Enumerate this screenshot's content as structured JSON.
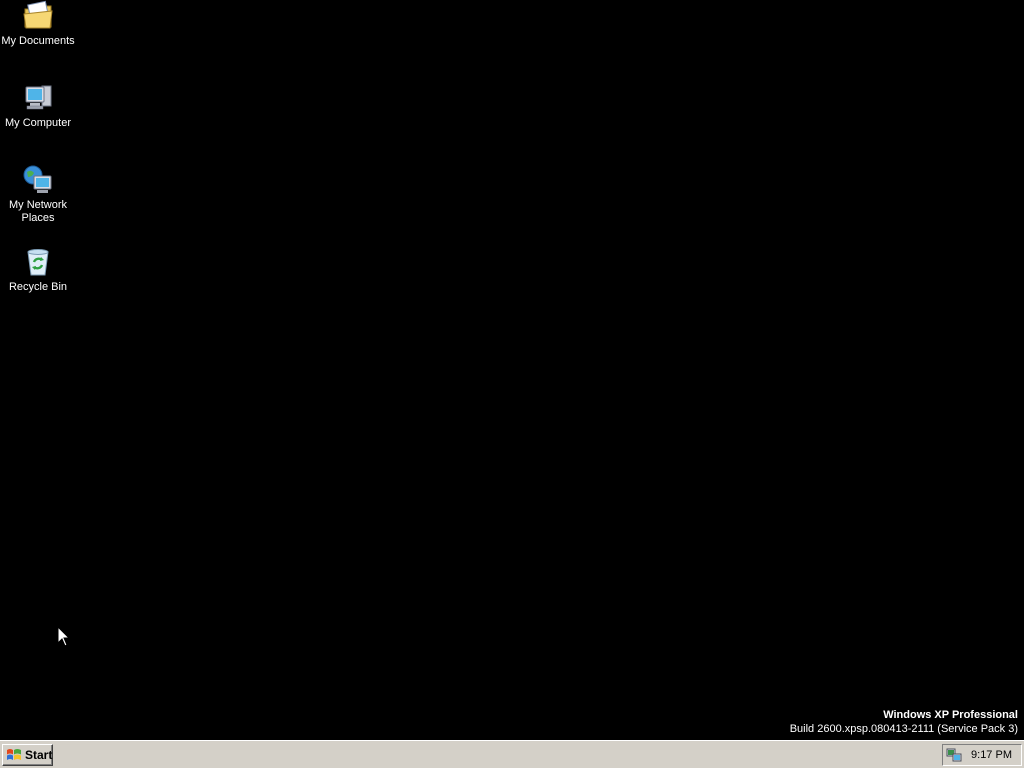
{
  "desktop": {
    "background_color": "#000000",
    "icons": [
      {
        "label": "My Documents",
        "icon": "my-documents-icon"
      },
      {
        "label": "My Computer",
        "icon": "my-computer-icon"
      },
      {
        "label": "My Network Places",
        "icon": "my-network-places-icon"
      },
      {
        "label": "Recycle Bin",
        "icon": "recycle-bin-icon"
      }
    ],
    "watermark": {
      "title": "Windows XP Professional",
      "build": "Build 2600.xpsp.080413-2111 (Service Pack 3)"
    }
  },
  "taskbar": {
    "background_color": "#d4d0c8",
    "start_label": "Start",
    "start_icon": "windows-flag-icon",
    "tray": {
      "icon": "network-connection-icon",
      "clock": "9:17 PM"
    }
  },
  "cursor": {
    "icon": "mouse-pointer-icon"
  }
}
